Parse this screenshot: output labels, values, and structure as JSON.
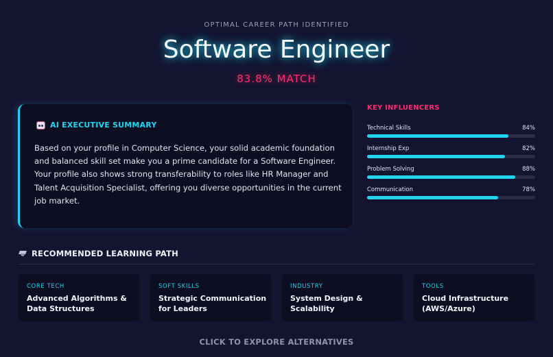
{
  "header": {
    "eyebrow": "OPTIMAL CAREER PATH IDENTIFIED",
    "title": "Software Engineer",
    "match": "83.8% MATCH"
  },
  "summary": {
    "icon": "robot-icon",
    "title": "AI EXECUTIVE SUMMARY",
    "text": "Based on your profile in Computer Science, your solid academic foundation and balanced skill set make you a prime candidate for a Software Engineer. Your profile also shows strong transferability to roles like HR Manager and Talent Acquisition Specialist, offering you diverse opportunities in the current job market."
  },
  "influencers": {
    "title": "KEY INFLUENCERS",
    "items": [
      {
        "label": "Technical Skills",
        "value": "84%",
        "percent": 84
      },
      {
        "label": "Internship Exp",
        "value": "82%",
        "percent": 82
      },
      {
        "label": "Problem Solving",
        "value": "88%",
        "percent": 88
      },
      {
        "label": "Communication",
        "value": "78%",
        "percent": 78
      }
    ]
  },
  "learning_path": {
    "icon": "graduation-cap-icon",
    "title": "RECOMMENDED LEARNING PATH",
    "cards": [
      {
        "category": "CORE TECH",
        "title": "Advanced Algorithms & Data Structures"
      },
      {
        "category": "SOFT SKILLS",
        "title": "Strategic Communication for Leaders"
      },
      {
        "category": "INDUSTRY",
        "title": "System Design & Scalability"
      },
      {
        "category": "TOOLS",
        "title": "Cloud Infrastructure (AWS/Azure)"
      }
    ]
  },
  "footer": {
    "explore_label": "CLICK TO EXPLORE ALTERNATIVES"
  },
  "colors": {
    "background": "#141430",
    "accent": "#22d3ee",
    "highlight": "#ff2e6e",
    "panel": "#0e0e22"
  }
}
